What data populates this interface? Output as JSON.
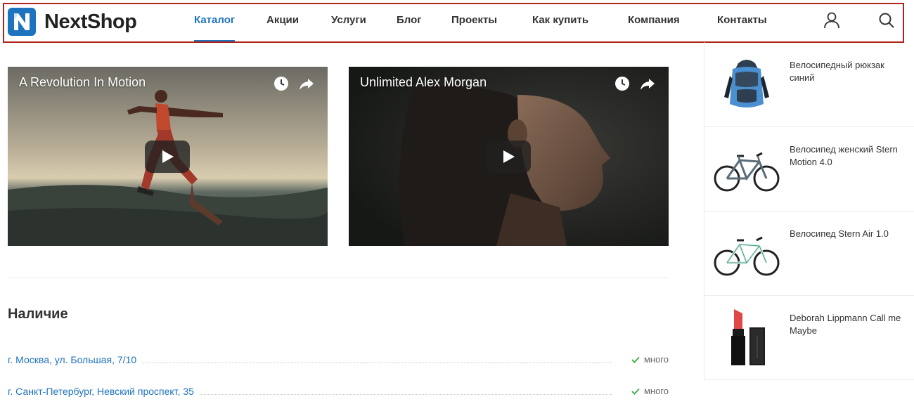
{
  "brand": {
    "name": "NextShop",
    "accent": "#1e73be"
  },
  "nav": [
    {
      "label": "Каталог",
      "active": true
    },
    {
      "label": "Акции"
    },
    {
      "label": "Услуги"
    },
    {
      "label": "Блог"
    },
    {
      "label": "Проекты"
    },
    {
      "label": "Как купить"
    },
    {
      "label": "Компания"
    },
    {
      "label": "Контакты"
    }
  ],
  "header_icons": [
    "user-icon",
    "search-icon"
  ],
  "videos": [
    {
      "title": "A Revolution In Motion",
      "icons": [
        "clock-icon",
        "share-icon",
        "play-icon"
      ]
    },
    {
      "title": "Unlimited Alex Morgan",
      "icons": [
        "clock-icon",
        "share-icon",
        "play-icon"
      ]
    }
  ],
  "availability": {
    "title": "Наличие",
    "stores": [
      {
        "address": "г. Москва, ул. Большая, 7/10",
        "status": "много"
      },
      {
        "address": "г. Санкт-Петербург, Невский проспект, 35",
        "status": "много"
      }
    ],
    "status_color": "#4caf50"
  },
  "side_products": [
    {
      "name": "Велосипедный рюкзак синий",
      "icon": "backpack-image"
    },
    {
      "name": "Велосипед женский Stern Motion 4.0",
      "icon": "bicycle-image"
    },
    {
      "name": "Велосипед Stern Air 1.0",
      "icon": "bicycle-image"
    },
    {
      "name": "Deborah Lippmann Call me Maybe",
      "icon": "lipstick-image"
    }
  ]
}
